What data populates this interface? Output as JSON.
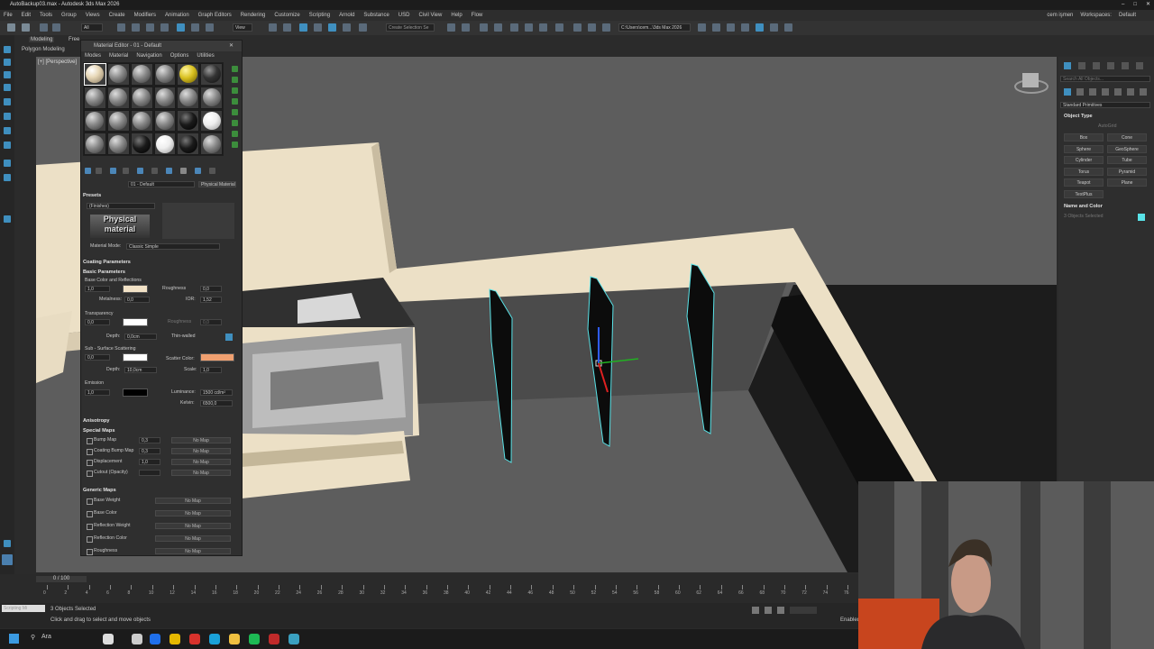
{
  "app": {
    "title": "AutoBackup03.max - Autodesk 3ds Max 2026",
    "user": "cem işmen",
    "workspaces_label": "Workspaces:",
    "workspace_value": "Default"
  },
  "menu": [
    "File",
    "Edit",
    "Tools",
    "Group",
    "Views",
    "Create",
    "Modifiers",
    "Animation",
    "Graph Editors",
    "Rendering",
    "Customize",
    "Scripting",
    "Arnold",
    "Substance",
    "USD",
    "Civil View",
    "Help",
    "Flow"
  ],
  "toolbar": {
    "selection_set_placeholder": "Create Selection Se",
    "path": "C:\\Users\\cem...\\3ds Max 2026",
    "view_dropdown": "View",
    "filter_dropdown": "All"
  },
  "ribbon": {
    "tab_modeling": "Modeling",
    "tab_freeform": "Free",
    "subtab": "Polygon Modeling"
  },
  "viewport": {
    "label": "[+] [Perspective]"
  },
  "material_editor": {
    "title": "Material Editor - 01 - Default",
    "menu": [
      "Modes",
      "Material",
      "Navigation",
      "Options",
      "Utilities"
    ],
    "slots": [
      "tan",
      "grey",
      "grey",
      "grey",
      "yellow",
      "dark",
      "grey",
      "grey",
      "grey",
      "grey",
      "grey",
      "grey",
      "grey",
      "grey",
      "grey",
      "grey",
      "black",
      "white",
      "grey",
      "grey",
      "black",
      "white",
      "black",
      "grey"
    ],
    "material_name": "01 - Default",
    "material_type": "Physical Material",
    "presets": {
      "header": "Presets",
      "dropdown": "(Finishes)",
      "logo_text": "Physical material",
      "material_mode_label": "Material Mode:",
      "material_mode_value": "Classic Simple"
    },
    "coating_header": "Coating Parameters",
    "basic_header": "Basic Parameters",
    "base_color_label": "Base Color and Reflections",
    "base_weight": "1,0",
    "roughness_label": "Roughness",
    "roughness_value": "0,0",
    "metalness_label": "Metalness:",
    "metalness_value": "0,0",
    "ior_label": "IOR:",
    "ior_value": "1,52",
    "transparency_label": "Transparency",
    "transparency_value": "0,0",
    "trans_roughness_label": "Roughness",
    "trans_roughness_value": "0,0",
    "depth_label": "Depth:",
    "depth_value": "0,0cm",
    "thin_walled_label": "Thin-walled",
    "sss_label": "Sub - Surface Scattering",
    "sss_value": "0,0",
    "scatter_color_label": "Scatter Color:",
    "sss_depth_value": "10,0cm",
    "scale_label": "Scale:",
    "scale_value": "1,0",
    "emission_label": "Emission",
    "emission_value": "1,0",
    "luminance_label": "Luminance:",
    "luminance_value": "1500 cd/m²",
    "kelvin_label": "Kelvin:",
    "kelvin_value": "6500,0",
    "anisotropy_header": "Anisotropy",
    "special_maps_header": "Special Maps",
    "special_maps": [
      {
        "label": "Bump Map",
        "value": "0,3",
        "map": "No Map"
      },
      {
        "label": "Coating Bump Map",
        "value": "0,3",
        "map": "No Map"
      },
      {
        "label": "Displacement",
        "value": "1,0",
        "map": "No Map"
      },
      {
        "label": "Cutout (Opacity)",
        "value": "",
        "map": "No Map"
      }
    ],
    "generic_maps_header": "Generic Maps",
    "generic_maps": [
      {
        "label": "Base Weight",
        "map": "No Map"
      },
      {
        "label": "Base Color",
        "map": "No Map"
      },
      {
        "label": "Reflection Weight",
        "map": "No Map"
      },
      {
        "label": "Reflection Color",
        "map": "No Map"
      },
      {
        "label": "Roughness",
        "map": "No Map"
      }
    ]
  },
  "command_panel": {
    "search_placeholder": "Search All Objects...",
    "category": "Standard Primitives",
    "object_type_header": "Object Type",
    "autogrid": "AutoGrid",
    "buttons": [
      "Box",
      "Cone",
      "Sphere",
      "GeoSphere",
      "Cylinder",
      "Tube",
      "Torus",
      "Pyramid",
      "Teapot",
      "Plane",
      "TextPlus"
    ],
    "name_color_header": "Name and Color",
    "name_value": "3 Objects Selected"
  },
  "timeline": {
    "frame": "0 / 100",
    "ticks": [
      "0",
      "2",
      "4",
      "6",
      "8",
      "10",
      "12",
      "14",
      "16",
      "18",
      "20",
      "22",
      "24",
      "26",
      "28",
      "30",
      "32",
      "34",
      "36",
      "38",
      "40",
      "42",
      "44",
      "46",
      "48",
      "50",
      "52",
      "54",
      "56",
      "58",
      "60",
      "62",
      "64",
      "66",
      "68",
      "70",
      "72",
      "74",
      "76"
    ]
  },
  "status": {
    "selection": "3 Objects Selected",
    "prompt": "Click and drag to select and move objects",
    "script_label": "Scripting Mi",
    "enabled": "Enabled"
  },
  "taskbar": {
    "search": "Ara"
  },
  "colors": {
    "accent": "#3f8fbf",
    "scatter": "#f0a070",
    "base_color": "#f2e2c6",
    "wall": "#ece0c6",
    "selection": "#59e3e8"
  }
}
